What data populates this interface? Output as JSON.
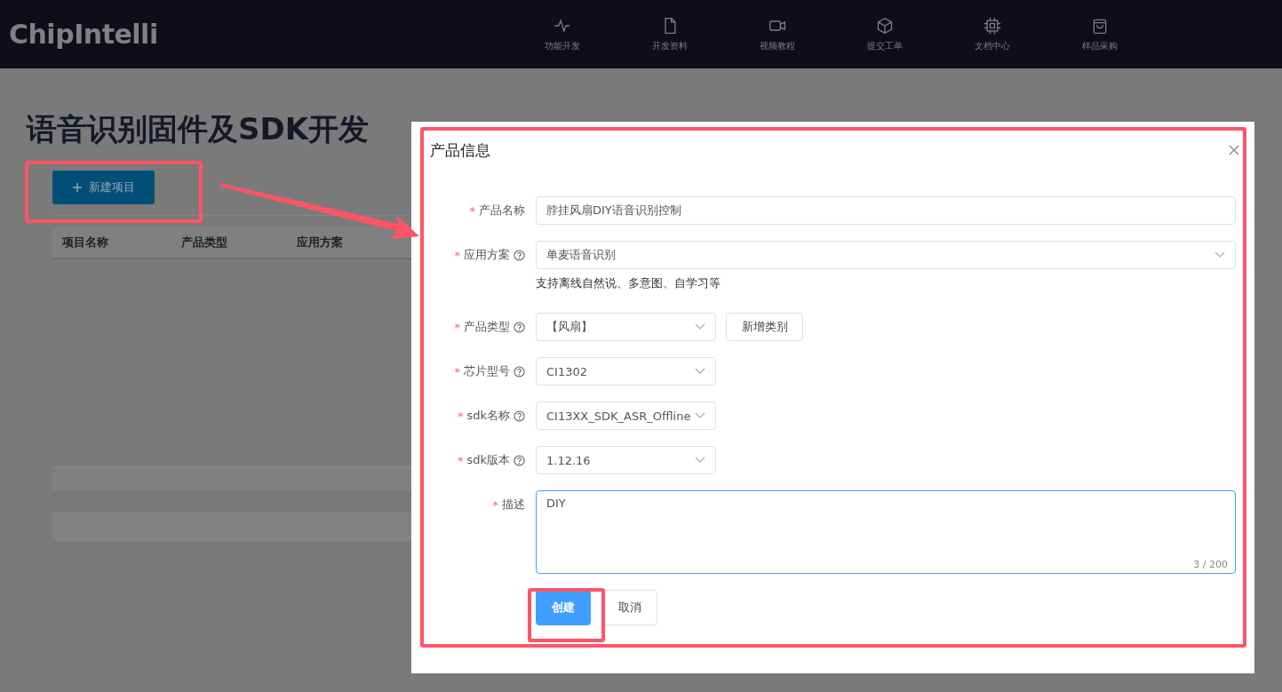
{
  "header": {
    "logo": "ChipIntelli",
    "nav": [
      {
        "label": "功能开发"
      },
      {
        "label": "开发资料"
      },
      {
        "label": "视频教程"
      },
      {
        "label": "提交工单"
      },
      {
        "label": "文档中心"
      },
      {
        "label": "样品采购"
      }
    ]
  },
  "page": {
    "title": "语音识别固件及SDK开发",
    "new_button": "新建项目",
    "table": {
      "columns": [
        "项目名称",
        "产品类型",
        "应用方案"
      ]
    }
  },
  "dialog": {
    "title": "产品信息",
    "fields": [
      {
        "label": "产品名称",
        "kind": "input",
        "required": "*",
        "help": false,
        "value": "脖挂风扇DIY语音识别控制"
      },
      {
        "label": "应用方案",
        "kind": "wide-select",
        "required": "*",
        "help": true,
        "value": "单麦语音识别",
        "hint": "支持离线自然说、多意图、自学习等"
      },
      {
        "label": "产品类型",
        "kind": "select",
        "required": "*",
        "help": true,
        "value": "【风扇】",
        "action": "新增类别"
      },
      {
        "label": "芯片型号",
        "kind": "select",
        "required": "*",
        "help": true,
        "value": "CI1302"
      },
      {
        "label": "sdk名称",
        "kind": "select",
        "required": "*",
        "help": true,
        "value": "CI13XX_SDK_ASR_Offline"
      },
      {
        "label": "sdk版本",
        "kind": "select",
        "required": "*",
        "help": true,
        "value": "1.12.16"
      },
      {
        "label": "描述",
        "kind": "textarea",
        "required": "*",
        "help": false,
        "value": "DIY",
        "count": "3 / 200",
        "focused": true
      }
    ],
    "buttons": [
      {
        "label": "创建",
        "kind": "primary"
      },
      {
        "label": "取消",
        "kind": "default"
      }
    ]
  }
}
